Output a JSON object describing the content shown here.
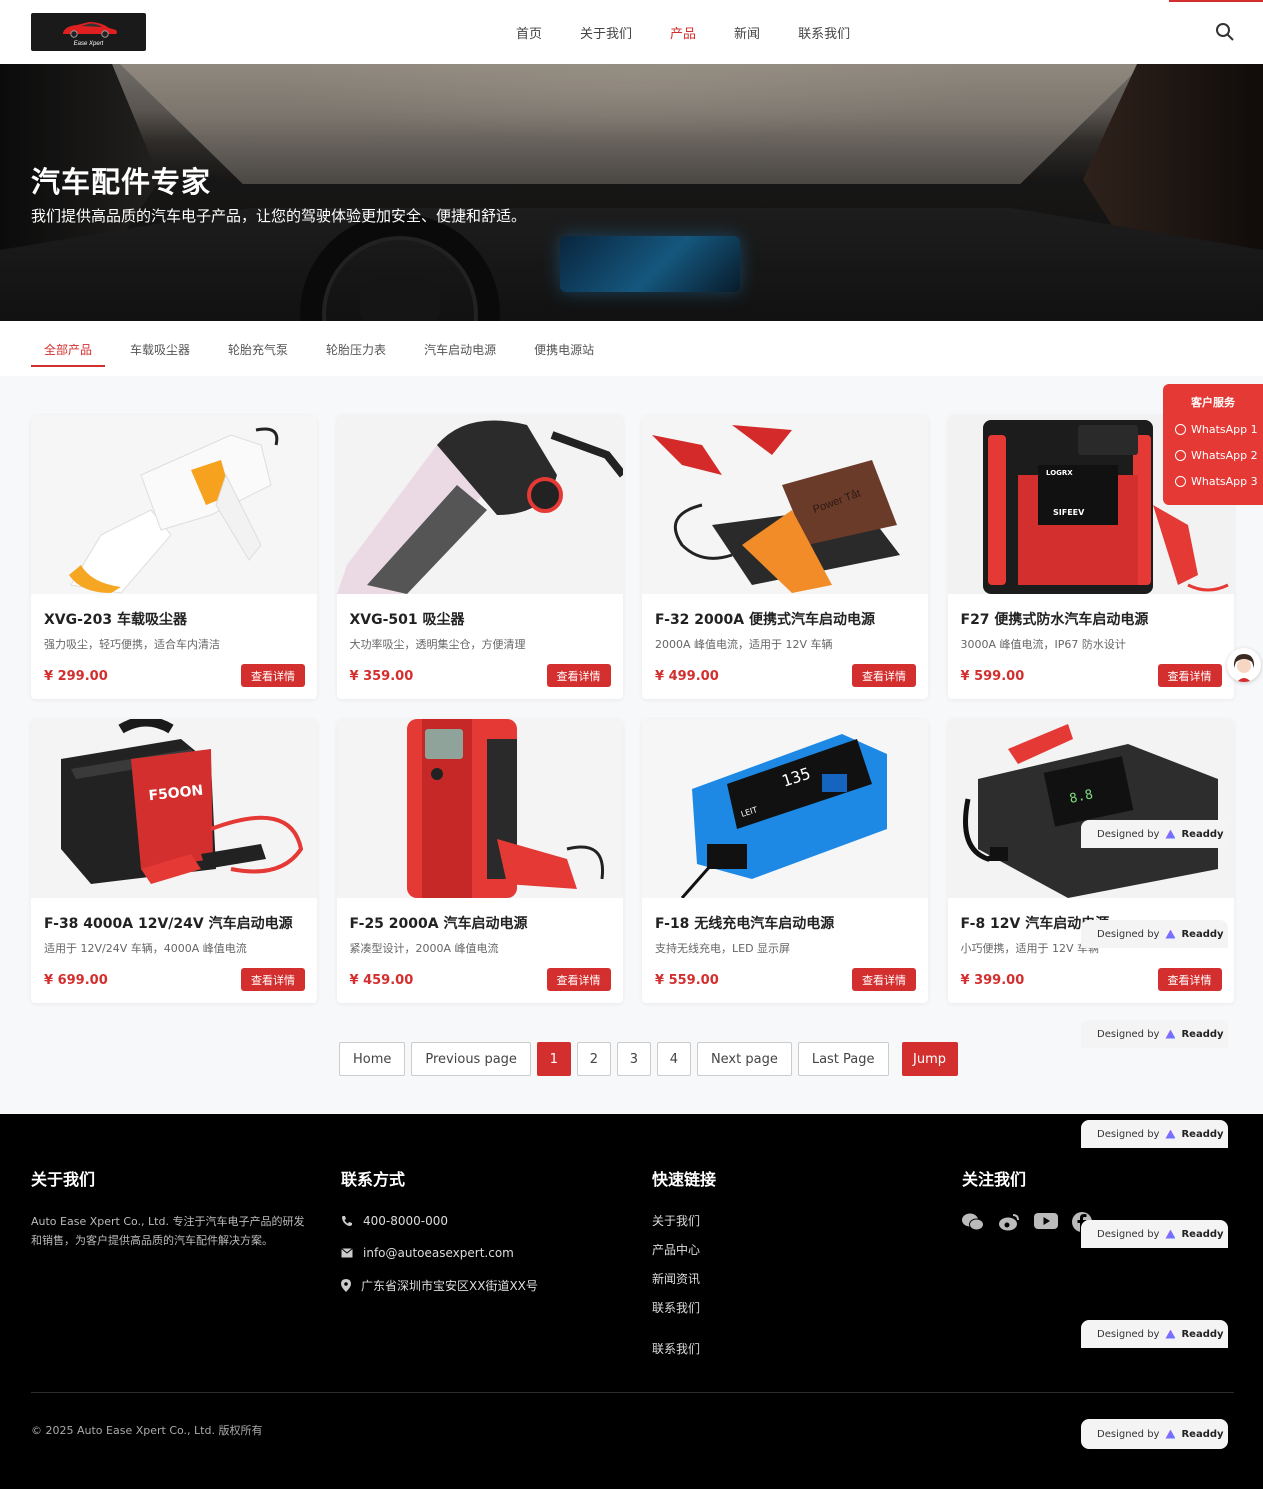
{
  "header": {
    "logo_text": "Ease Xpert",
    "nav": [
      "首页",
      "关于我们",
      "产品",
      "新闻",
      "联系我们"
    ],
    "active_nav": "产品"
  },
  "hero": {
    "title": "汽车配件专家",
    "subtitle": "我们提供高品质的汽车电子产品，让您的驾驶体验更加安全、便捷和舒适。"
  },
  "tabs": [
    "全部产品",
    "车载吸尘器",
    "轮胎充气泵",
    "轮胎压力表",
    "汽车启动电源",
    "便携电源站"
  ],
  "active_tab": "全部产品",
  "products": [
    {
      "name": "XVG-203 车载吸尘器",
      "desc": "强力吸尘，轻巧便携，适合车内清洁",
      "price": "¥ 299.00",
      "button": "查看详情",
      "image": "white-orange-handheld-vacuum"
    },
    {
      "name": "XVG-501 吸尘器",
      "desc": "大功率吸尘，透明集尘仓，方便清理",
      "price": "¥ 359.00",
      "button": "查看详情",
      "image": "black-transparent-vacuum"
    },
    {
      "name": "F-32 2000A 便携式汽车启动电源",
      "desc": "2000A 峰值电流，适用于 12V 车辆",
      "price": "¥ 499.00",
      "button": "查看详情",
      "image": "brown-jump-starter-with-clamps"
    },
    {
      "name": "F27 便携式防水汽车启动电源",
      "desc": "3000A 峰值电流，IP67 防水设计",
      "price": "¥ 599.00",
      "button": "查看详情",
      "image": "red-black-rugged-jump-starter"
    },
    {
      "name": "F-38 4000A 12V/24V 汽车启动电源",
      "desc": "适用于 12V/24V 车辆，4000A 峰值电流",
      "price": "¥ 699.00",
      "button": "查看详情",
      "image": "black-red-box-jump-starter"
    },
    {
      "name": "F-25 2000A 汽车启动电源",
      "desc": "紧凑型设计，2000A 峰值电流",
      "price": "¥ 459.00",
      "button": "查看详情",
      "image": "red-upright-jump-starter"
    },
    {
      "name": "F-18 无线充电汽车启动电源",
      "desc": "支持无线充电，LED 显示屏",
      "price": "¥ 559.00",
      "button": "查看详情",
      "image": "blue-jump-starter-display"
    },
    {
      "name": "F-8 12V 汽车启动电源",
      "desc": "小巧便携，适用于 12V 车辆",
      "price": "¥ 399.00",
      "button": "查看详情",
      "image": "dark-jump-starter-digital"
    }
  ],
  "screen_texts": {
    "powertat": "Power Tåt",
    "logrx": "LOGRX",
    "sifeev": "SIFEEV",
    "f50on": "F5OON",
    "display_135": "135",
    "leit": "LEIT"
  },
  "pagination": {
    "home": "Home",
    "prev": "Previous page",
    "pages": [
      "1",
      "2",
      "3",
      "4"
    ],
    "current": "1",
    "next": "Next page",
    "last": "Last Page",
    "jump": "Jump"
  },
  "customer_service": {
    "title": "客户服务",
    "items": [
      "WhatsApp 1",
      "WhatsApp 2",
      "WhatsApp 3"
    ]
  },
  "footer": {
    "about_title": "关于我们",
    "about_text": "Auto Ease Xpert Co., Ltd. 专注于汽车电子产品的研发和销售，为客户提供高品质的汽车配件解决方案。",
    "contact_title": "联系方式",
    "phone": "400-8000-000",
    "email": "info@autoeasexpert.com",
    "address": "广东省深圳市宝安区XX街道XX号",
    "links_title": "快速链接",
    "links": [
      "关于我们",
      "产品中心",
      "新闻资讯",
      "联系我们"
    ],
    "extra_link": "联系我们",
    "follow_title": "关注我们",
    "social": [
      "wechat-icon",
      "weibo-icon",
      "youtube-icon",
      "facebook-icon"
    ],
    "copyright": "© 2025 Auto Ease Xpert Co., Ltd. 版权所有"
  },
  "badge": {
    "prefix": "Designed by",
    "brand": "Readdy"
  },
  "colors": {
    "accent": "#d32f2f",
    "footer_bg": "#000000",
    "products_bg": "#f7f8fa"
  }
}
